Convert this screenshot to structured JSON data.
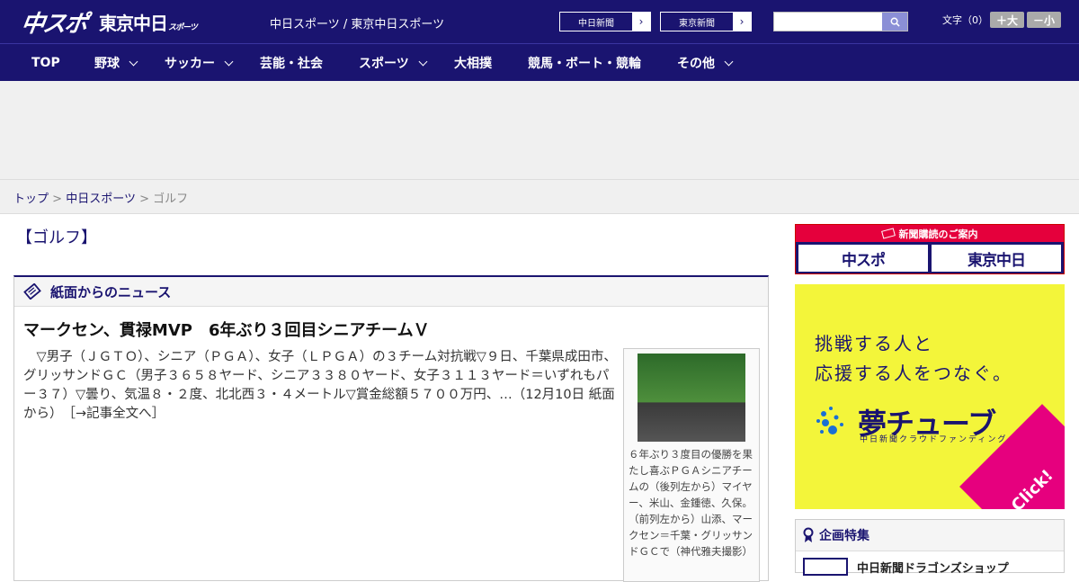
{
  "header": {
    "logo_main": "中スポ",
    "logo_sub": "東京中日",
    "logo_sub_small": "スポーツ",
    "tagline": "中日スポーツ / 東京中日スポーツ",
    "paper_links": [
      "中日新聞",
      "東京新聞"
    ],
    "search_placeholder": "",
    "fontsize_label": "文字（0）",
    "font_larger": "＋大",
    "font_smaller": "－小"
  },
  "nav": {
    "items": [
      {
        "label": "TOP",
        "has_dropdown": false
      },
      {
        "label": "野球",
        "has_dropdown": true
      },
      {
        "label": "サッカー",
        "has_dropdown": true
      },
      {
        "label": "芸能・社会",
        "has_dropdown": false
      },
      {
        "label": "スポーツ",
        "has_dropdown": true
      },
      {
        "label": "大相撲",
        "has_dropdown": false
      },
      {
        "label": "競馬・ボート・競輪",
        "has_dropdown": false
      },
      {
        "label": "その他",
        "has_dropdown": true
      }
    ]
  },
  "breadcrumb": {
    "items": [
      "トップ",
      "中日スポーツ",
      "ゴルフ"
    ],
    "separator": ">"
  },
  "page_title": "【ゴルフ】",
  "news": {
    "box_label": "紙面からのニュース",
    "headline": "マークセン、貫禄MVP　6年ぶり３回目シニアチームＶ",
    "lede": "　▽男子（ＪＧＴＯ）、シニア（ＰＧＡ）、女子（ＬＰＧＡ）の３チーム対抗戦▽９日、千葉県成田市、グリッサンドＧＣ（男子３６５８ヤード、シニア３３８０ヤード、女子３１１３ヤード＝いずれもパー３７）▽曇り、気温８・２度、北北西３・４メートル▽賞金総額５７００万円、…（12月10日 紙面から）",
    "more_link": "［→記事全文へ］",
    "photo_caption": "６年ぶり３度目の優勝を果たし喜ぶＰＧＡシニアチームの（後列左から）マイヤー、米山、金鍾徳、久保。（前列左から）山添、マークセン＝千葉・グリッサンドＧＣで（神代雅夫撮影）"
  },
  "sidebar": {
    "subscribe_bar": "新聞購読のご案内",
    "subscribe_logos": [
      "中スポ",
      "東京中日"
    ],
    "yume_copy_1": "挑戦する人と",
    "yume_copy_2": "応援する人をつなぐ。",
    "yume_brand": "夢チューブ",
    "yume_brand_sub": "中日新聞クラウドファンディング",
    "yume_click": "Click!",
    "feature_label": "企画特集",
    "feature_item": "中日新聞ドラゴンズショップ"
  },
  "colors": {
    "brand_navy": "#1a1470",
    "accent_red": "#e5003c",
    "yume_yellow": "#f3f53a",
    "click_magenta": "#e6007e"
  }
}
